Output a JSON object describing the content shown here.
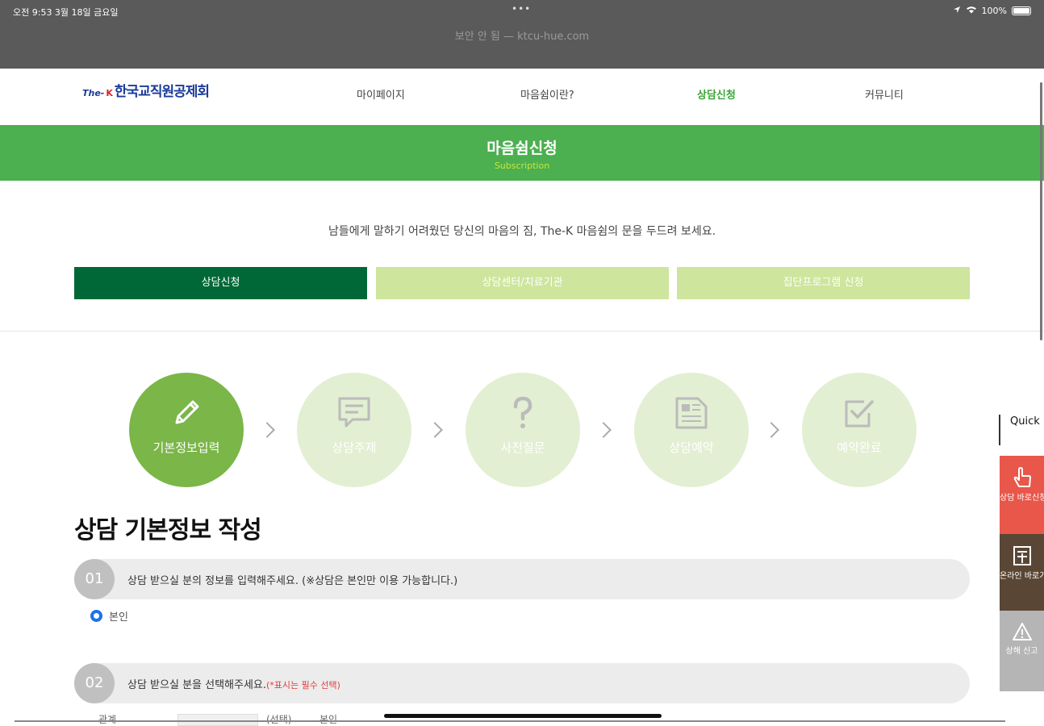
{
  "status": {
    "time": "오전 9:53  3월 18일 금요일",
    "dots": "•••",
    "battery": "100%"
  },
  "browser": {
    "url": "보안 안 됨 — ktcu-hue.com"
  },
  "header": {
    "logo_the": "The-",
    "logo_k": "K",
    "logo_name": "한국교직원공제회",
    "nav": [
      "마이페이지",
      "마음쉼이란?",
      "상담신청",
      "커뮤니티"
    ],
    "active_nav": "상담신청"
  },
  "banner": {
    "title": "마음쉼신청",
    "subtitle": "Subscription"
  },
  "intro": "남들에게 말하기 어려웠던 당신의 마음의 짐, The-K 마음쉼의 문을 두드려 보세요.",
  "tabs": [
    "상담신청",
    "상담센터/치료기관",
    "집단프로그램 신청"
  ],
  "steps": [
    "기본정보입력",
    "상담주제",
    "사전질문",
    "상담예약",
    "예약완료"
  ],
  "section_title": "상담 기본정보 작성",
  "questions": [
    {
      "num": "01",
      "text": "상담 받으실 분의 정보를 입력해주세요. (※상담은 본인만 이용 가능합니다.)",
      "note": ""
    },
    {
      "num": "02",
      "text": "상담 받으실 분을 선택해주세요.",
      "note": "(*표시는 필수 선택)"
    }
  ],
  "radio": {
    "label": "본인"
  },
  "partial": {
    "label1": "관계",
    "label2": "(선택)",
    "label3": "본인"
  },
  "quick_menu": {
    "title": "Quick Menu",
    "items": [
      {
        "label": "상담 바로신청",
        "color": "#e8574a"
      },
      {
        "label": "온라인 바로가기",
        "color": "#5a4634"
      },
      {
        "label": "상해 신고",
        "color": "#b5b5b5"
      }
    ]
  },
  "colors": {
    "banner": "#4caf50",
    "active_tab": "#006837",
    "inactive_tab": "#cde59d",
    "active_step": "#7ab648",
    "inactive_step": "#e2efd2"
  }
}
